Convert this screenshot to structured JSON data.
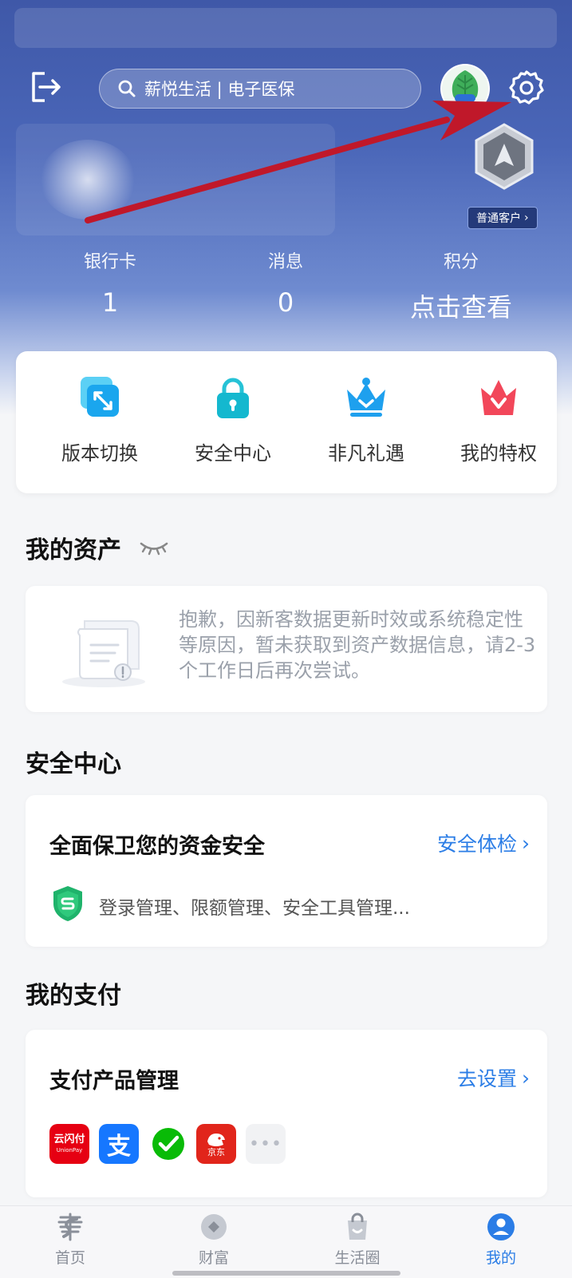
{
  "search": {
    "placeholder": "薪悦生活 | 电子医保"
  },
  "profile": {
    "level_tag": "普通客户"
  },
  "stats": [
    {
      "label": "银行卡",
      "value": "1"
    },
    {
      "label": "消息",
      "value": "0"
    },
    {
      "label": "积分",
      "value": "点击查看"
    }
  ],
  "quick_actions": [
    {
      "label": "版本切换",
      "icon": "switch-icon"
    },
    {
      "label": "安全中心",
      "icon": "lock-icon"
    },
    {
      "label": "非凡礼遇",
      "icon": "crown-icon"
    },
    {
      "label": "我的特权",
      "icon": "privilege-icon"
    }
  ],
  "assets": {
    "title": "我的资产",
    "message": "抱歉，因新客数据更新时效或系统稳定性等原因，暂未获取到资产数据信息，请2-3个工作日后再次尝试。"
  },
  "security": {
    "title": "安全中心",
    "card_title": "全面保卫您的资金安全",
    "link": "安全体检",
    "desc": "登录管理、限额管理、安全工具管理..."
  },
  "payment": {
    "title": "我的支付",
    "card_title": "支付产品管理",
    "link": "去设置",
    "products": [
      {
        "name": "云闪付",
        "sub": "UnionPay",
        "color": "#e60012"
      },
      {
        "name": "支",
        "color": "#1677ff"
      },
      {
        "name": "wechat-pay",
        "color": "#ffffff"
      },
      {
        "name": "京东",
        "color": "#e1251b"
      },
      {
        "name": "more",
        "color": "#f1f2f4"
      }
    ]
  },
  "bottom_nav": [
    {
      "label": "首页",
      "icon": "home-icon"
    },
    {
      "label": "财富",
      "icon": "wealth-icon"
    },
    {
      "label": "生活圈",
      "icon": "life-icon"
    },
    {
      "label": "我的",
      "icon": "me-icon",
      "active": true
    }
  ],
  "colors": {
    "accent": "#2b7de6",
    "header": "#4a66b8",
    "arrow": "#c0182a"
  }
}
